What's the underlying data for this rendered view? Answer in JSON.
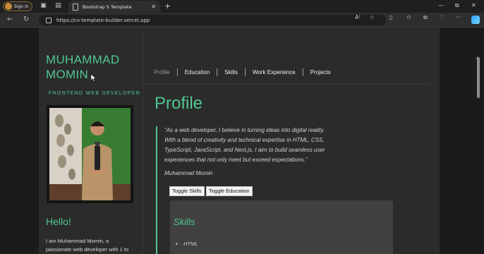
{
  "browser": {
    "profile_label": "Sign in",
    "tab_title": "Bootstrap 5 Template",
    "url": "https://cv-template-builder.vercel.app"
  },
  "page": {
    "name_line1": "MUHAMMAD",
    "name_line2": "MOMIN",
    "role": "FRONTEND WEB DEVELOPER",
    "nav": [
      "Profile",
      "Education",
      "Skills",
      "Work Experience",
      "Projects"
    ],
    "section_title": "Profile",
    "quote_lines": [
      "\"As a web developer, I believe in turning ideas into digital reality.",
      "With a blend of creativity and technical expertise in HTML, CSS,",
      "TypeScript, JavaScript, and Next.js, I aim to build seamless user",
      "experiences that not only meet but exceed expectations.\""
    ],
    "author": "Muhammad Momin",
    "buttons": {
      "toggle_skills": "Toggle Skills",
      "toggle_education": "Toggle Education"
    },
    "skills_title": "Skills",
    "skills": [
      "HTML"
    ],
    "hello": "Hello!",
    "intro_lines": [
      "I am Muhammad Momin, a",
      "passionate web developer with 1 to"
    ]
  },
  "colors": {
    "accent": "#51c790",
    "page_bg": "#2b2b2b",
    "card_bg": "#404040"
  },
  "icons": [
    "profile-avatar-icon",
    "workspaces-icon",
    "tab-actions-icon",
    "document-icon",
    "close-icon",
    "new-tab-icon",
    "minimize-icon",
    "restore-icon",
    "window-close-icon",
    "back-icon",
    "refresh-icon",
    "lock-icon",
    "read-aloud-icon",
    "favorite-icon",
    "split-screen-icon",
    "favorites-icon",
    "collections-icon",
    "browser-essentials-icon",
    "more-icon",
    "copilot-icon"
  ]
}
